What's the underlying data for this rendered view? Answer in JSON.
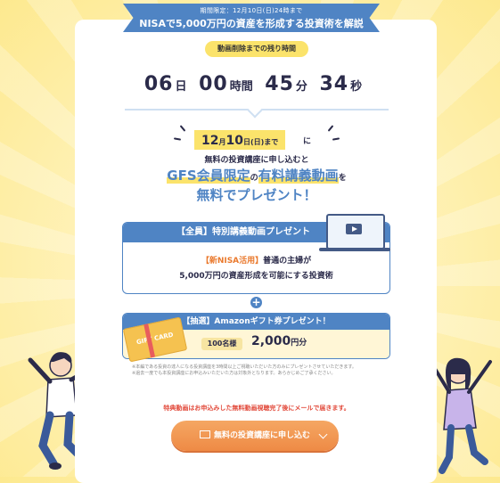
{
  "banner": {
    "top_text": "期間限定：12月10日(日)24時まで",
    "title": "NISAで5,000万円の資産を形成する投資術を解説"
  },
  "timer": {
    "label": "動画削除までの残り時間",
    "days": "06",
    "days_unit": "日",
    "hours": "00",
    "hours_unit": "時間",
    "minutes": "45",
    "minutes_unit": "分",
    "seconds": "34",
    "seconds_unit": "秒"
  },
  "offer": {
    "deadline_month": "12",
    "deadline_month_unit": "月",
    "deadline_day": "10",
    "deadline_day_unit": "日",
    "deadline_weekday": "(日)",
    "deadline_suffix": "まで",
    "deadline_after": "に",
    "apply_text": "無料の投資講座に申し込むと",
    "gfs_part1": "GFS会員限定",
    "gfs_part2": "の",
    "gfs_part3": "有料講義動画",
    "gfs_part4": "を",
    "free_text": "無料でプレゼント！"
  },
  "box1": {
    "header": "【全員】特別講義動画プレゼント",
    "line1_highlight": "【新NISA活用】",
    "line1_rest": "普通の主婦が",
    "line2": "5,000万円の資産形成を可能にする投資術"
  },
  "plus_symbol": "+",
  "box2": {
    "header": "【抽選】Amazonギフト券プレゼント！",
    "gift_card_label": "GIFT CARD",
    "winners": "100名様",
    "amount": "2,000",
    "amount_unit": "円分"
  },
  "notes": {
    "line1": "※本編である投資の達人になる投資講座を3時間以上ご視聴いただいた方のみにプレゼントさせていただきます。",
    "line2": "※過去一度でも本投資講座にお申込みいただいた方は対象外となります。あらかじめご了承ください。",
    "red_note": "特典動画はお申込みした無料動画視聴完了後にメールで届きます。"
  },
  "cta": {
    "label": "無料の投資講座に申し込む"
  },
  "colors": {
    "primary_blue": "#4f84c4",
    "highlight_yellow": "#fbe36b",
    "cta_orange": "#ee8a45",
    "alert_red": "#e24a3b"
  }
}
